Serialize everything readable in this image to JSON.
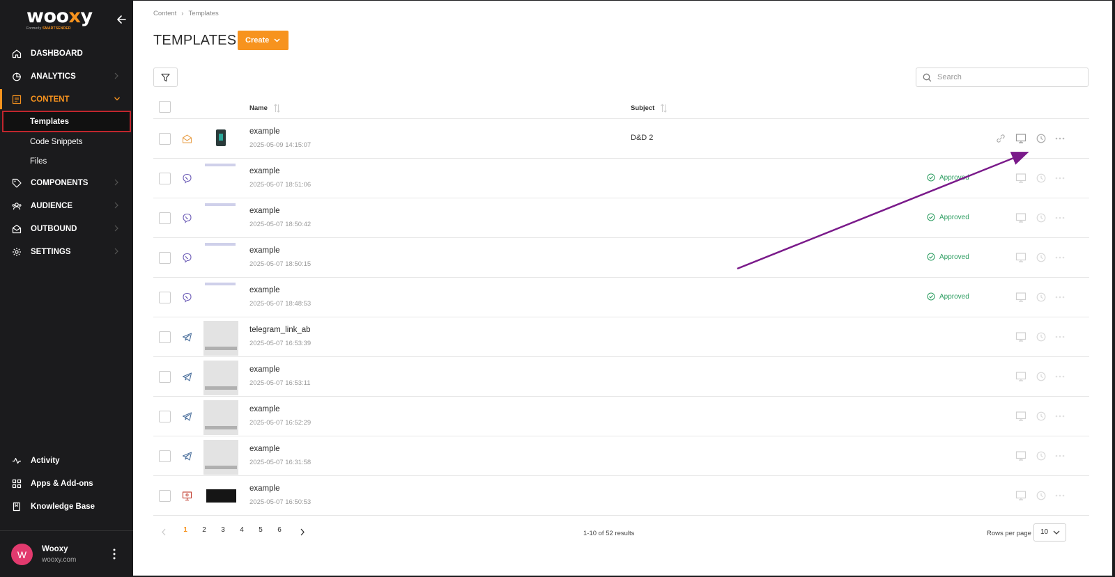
{
  "brand": {
    "name_prefix": "woo",
    "name_x": "x",
    "name_suffix": "y",
    "sub": "Formerly ",
    "sub_brand": "SMARTSENDER"
  },
  "sidebar": {
    "items": [
      {
        "label": "DASHBOARD",
        "icon": "home-icon"
      },
      {
        "label": "ANALYTICS",
        "icon": "pie-chart-icon"
      },
      {
        "label": "CONTENT",
        "icon": "content-list-icon"
      },
      {
        "label": "COMPONENTS",
        "icon": "tag-icon"
      },
      {
        "label": "AUDIENCE",
        "icon": "audience-icon"
      },
      {
        "label": "OUTBOUND",
        "icon": "envelope-open-icon"
      },
      {
        "label": "SETTINGS",
        "icon": "gear-icon"
      }
    ],
    "content_sub": [
      "Templates",
      "Code Snippets",
      "Files"
    ],
    "bottom": [
      {
        "label": "Activity",
        "icon": "activity-icon"
      },
      {
        "label": "Apps & Add-ons",
        "icon": "apps-icon"
      },
      {
        "label": "Knowledge Base",
        "icon": "book-icon"
      }
    ],
    "user": {
      "initial": "W",
      "name": "Wooxy",
      "email": "wooxy.com"
    }
  },
  "breadcrumb": [
    "Content",
    "Templates"
  ],
  "page_title": "TEMPLATES",
  "create_label": "Create",
  "search": {
    "placeholder": "Search"
  },
  "table": {
    "columns": {
      "name": "Name",
      "subject": "Subject"
    },
    "rows": [
      {
        "name": "example",
        "date": "2025-05-09 14:15:07",
        "subject": "D&D 2",
        "status": "",
        "type": "email-icon",
        "thumb": "phone"
      },
      {
        "name": "example",
        "date": "2025-05-07 18:51:06",
        "subject": "",
        "status": "Approved",
        "type": "viber-icon",
        "thumb": "viber"
      },
      {
        "name": "example",
        "date": "2025-05-07 18:50:42",
        "subject": "",
        "status": "Approved",
        "type": "viber-icon",
        "thumb": "viber"
      },
      {
        "name": "example",
        "date": "2025-05-07 18:50:15",
        "subject": "",
        "status": "Approved",
        "type": "viber-icon",
        "thumb": "viber"
      },
      {
        "name": "example",
        "date": "2025-05-07 18:48:53",
        "subject": "",
        "status": "Approved",
        "type": "viber-icon",
        "thumb": "viber"
      },
      {
        "name": "telegram_link_ab",
        "date": "2025-05-07 16:53:39",
        "subject": "",
        "status": "",
        "type": "telegram-icon",
        "thumb": "gray"
      },
      {
        "name": "example",
        "date": "2025-05-07 16:53:11",
        "subject": "",
        "status": "",
        "type": "telegram-icon",
        "thumb": "gray"
      },
      {
        "name": "example",
        "date": "2025-05-07 16:52:29",
        "subject": "",
        "status": "",
        "type": "telegram-icon",
        "thumb": "gray"
      },
      {
        "name": "example",
        "date": "2025-05-07 16:31:58",
        "subject": "",
        "status": "",
        "type": "telegram-icon",
        "thumb": "gray"
      },
      {
        "name": "example",
        "date": "2025-05-07 16:50:53",
        "subject": "",
        "status": "",
        "type": "web-push-icon",
        "thumb": "dark"
      }
    ]
  },
  "pagination": {
    "pages": [
      "1",
      "2",
      "3",
      "4",
      "5",
      "6"
    ],
    "current": "1",
    "info": "1-10 of 52 results",
    "rows_label": "Rows per page",
    "rows_value": "10"
  },
  "colors": {
    "accent": "#f7931e",
    "approved": "#2e9e62",
    "annotation_arrow": "#7a1a8a"
  }
}
